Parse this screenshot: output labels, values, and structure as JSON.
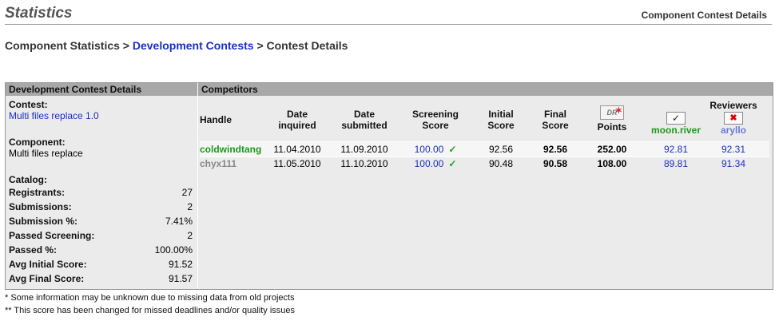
{
  "page": {
    "title": "Statistics",
    "subtitle": "Component Contest Details"
  },
  "breadcrumb": {
    "part1": "Component Statistics >",
    "link": "Development Contests",
    "part3": "> Contest Details"
  },
  "details": {
    "header": "Development Contest Details",
    "contest_label": "Contest:",
    "contest_value": "Multi files replace 1.0",
    "component_label": "Component:",
    "component_value": "Multi files replace",
    "catalog_label": "Catalog:",
    "stats": [
      {
        "label": "Registrants:",
        "value": "27"
      },
      {
        "label": "Submissions:",
        "value": "2"
      },
      {
        "label": "Submission %:",
        "value": "7.41%"
      },
      {
        "label": "Passed Screening:",
        "value": "2"
      },
      {
        "label": "Passed %:",
        "value": "100.00%"
      },
      {
        "label": "Avg Initial Score:",
        "value": "91.52"
      },
      {
        "label": "Avg Final Score:",
        "value": "91.57"
      }
    ]
  },
  "competitors": {
    "header": "Competitors",
    "reviewers_label": "Reviewers",
    "columns": {
      "handle": "Handle",
      "date_inquired": [
        "Date",
        "inquired"
      ],
      "date_submitted": [
        "Date",
        "submitted"
      ],
      "screening": [
        "Screening",
        "Score"
      ],
      "initial": [
        "Initial",
        "Score"
      ],
      "final": [
        "Final",
        "Score"
      ],
      "points": "Points",
      "dr_icon": "DR"
    },
    "reviewers": [
      {
        "name": "moon.river",
        "color": "#1a9a1a"
      },
      {
        "name": "aryllo",
        "color": "#6b7bd8"
      }
    ],
    "rows": [
      {
        "handle": "coldwindtang",
        "handle_color": "#1a9a1a",
        "inquired": "11.04.2010",
        "submitted": "11.09.2010",
        "screening": "100.00",
        "initial": "92.56",
        "final": "92.56",
        "points": "252.00",
        "r1": "92.81",
        "r2": "92.31"
      },
      {
        "handle": "chyx111",
        "handle_color": "#888888",
        "inquired": "11.05.2010",
        "submitted": "11.10.2010",
        "screening": "100.00",
        "initial": "90.48",
        "final": "90.58",
        "points": "108.00",
        "r1": "89.81",
        "r2": "91.34"
      }
    ]
  },
  "footnotes": [
    "* Some information may be unknown due to missing data from old projects",
    "** This score has been changed for missed deadlines and/or quality issues"
  ]
}
